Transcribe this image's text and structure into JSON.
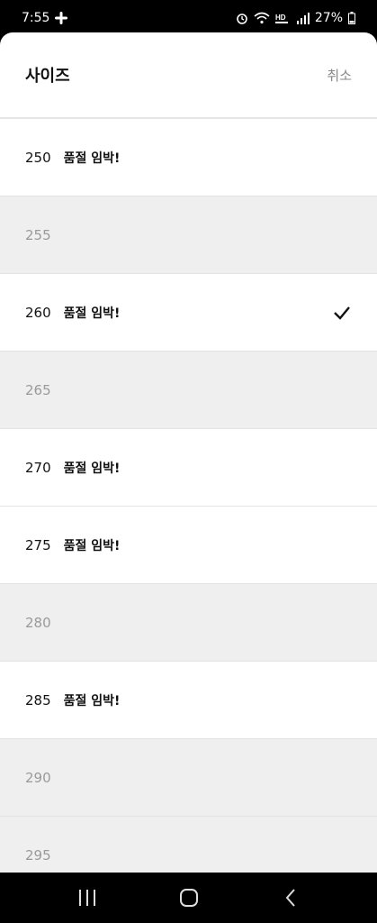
{
  "status_bar": {
    "time": "7:55",
    "battery": "27%"
  },
  "sheet": {
    "title": "사이즈",
    "cancel_label": "취소"
  },
  "sizes": [
    {
      "value": "250",
      "tag": "품절 임박!",
      "disabled": false,
      "selected": false
    },
    {
      "value": "255",
      "tag": "",
      "disabled": true,
      "selected": false
    },
    {
      "value": "260",
      "tag": "품절 임박!",
      "disabled": false,
      "selected": true
    },
    {
      "value": "265",
      "tag": "",
      "disabled": true,
      "selected": false
    },
    {
      "value": "270",
      "tag": "품절 임박!",
      "disabled": false,
      "selected": false
    },
    {
      "value": "275",
      "tag": "품절 임박!",
      "disabled": false,
      "selected": false
    },
    {
      "value": "280",
      "tag": "",
      "disabled": true,
      "selected": false
    },
    {
      "value": "285",
      "tag": "품절 임박!",
      "disabled": false,
      "selected": false
    },
    {
      "value": "290",
      "tag": "",
      "disabled": true,
      "selected": false
    },
    {
      "value": "295",
      "tag": "",
      "disabled": true,
      "selected": false
    }
  ],
  "icons": {
    "selected_check": "checkmark-icon"
  }
}
